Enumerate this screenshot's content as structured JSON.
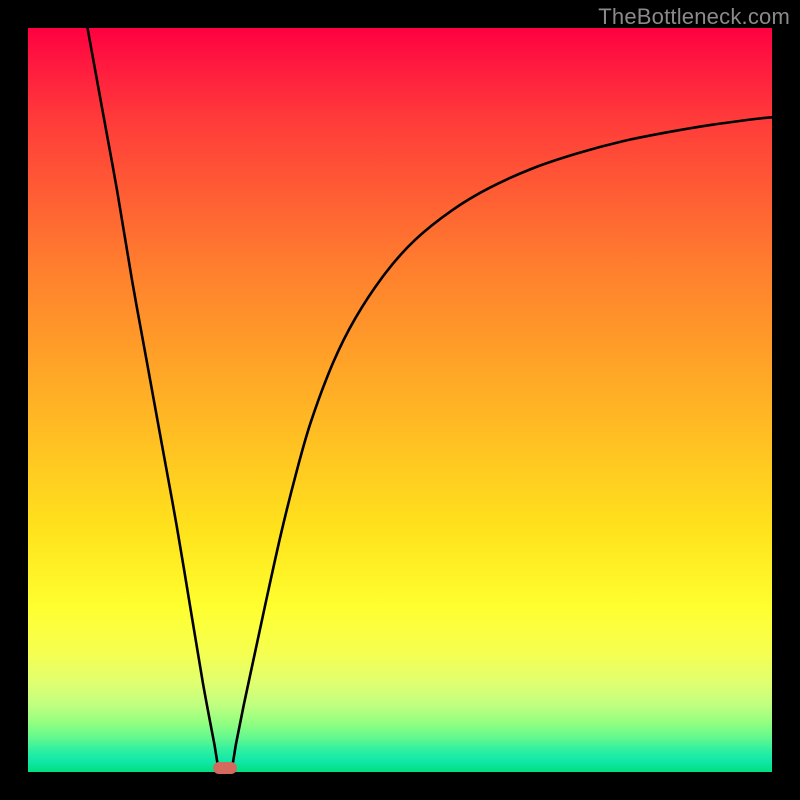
{
  "watermark": "TheBottleneck.com",
  "chart_data": {
    "type": "line",
    "title": "",
    "xlabel": "",
    "ylabel": "",
    "xlim": [
      0,
      100
    ],
    "ylim": [
      0,
      100
    ],
    "grid": false,
    "legend": false,
    "background": "red-yellow-green vertical gradient",
    "series": [
      {
        "name": "left-branch",
        "color": "#000000",
        "x": [
          8,
          10,
          12,
          14,
          16,
          18,
          20,
          22,
          23.5,
          25,
          25.8
        ],
        "y": [
          100,
          89,
          78,
          66,
          55,
          44,
          33,
          21,
          12,
          4,
          0
        ]
      },
      {
        "name": "right-branch",
        "color": "#000000",
        "x": [
          27.2,
          28,
          29,
          30.5,
          32,
          34,
          36,
          38,
          41,
          44,
          48,
          52,
          57,
          62,
          68,
          74,
          80,
          86,
          92,
          98,
          100
        ],
        "y": [
          0,
          4,
          9,
          16,
          23,
          32,
          40,
          47,
          55,
          61,
          67,
          71.5,
          75.5,
          78.5,
          81.2,
          83.2,
          84.8,
          86.0,
          87.0,
          87.8,
          88.0
        ]
      }
    ],
    "marker": {
      "x": 26.5,
      "y": 0.6,
      "color": "#d46a5e",
      "shape": "pill"
    }
  }
}
